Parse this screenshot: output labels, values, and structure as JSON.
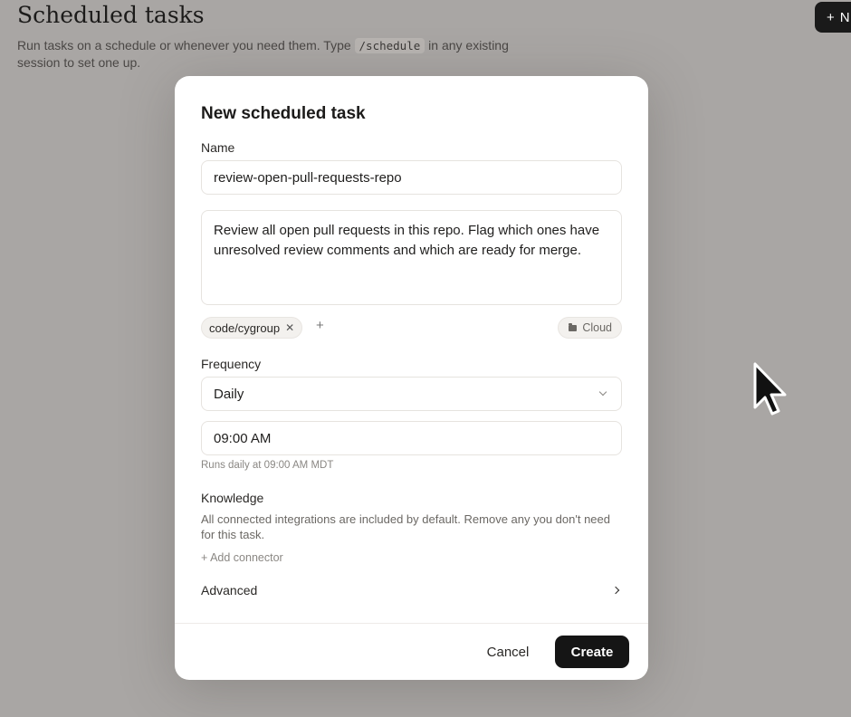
{
  "page": {
    "title": "Scheduled tasks",
    "subtitle_before": "Run tasks on a schedule or whenever you need them. Type",
    "subtitle_code": "/schedule",
    "subtitle_after": "in any existing session to set one up.",
    "new_button_label": "N"
  },
  "modal": {
    "title": "New scheduled task",
    "name_label": "Name",
    "name_value": "review-open-pull-requests-repo",
    "prompt_value": "Review all open pull requests in this repo. Flag which ones have unresolved review comments and which are ready for merge.",
    "repo_chip": "code/cygroup",
    "environment_chip": "Cloud",
    "frequency_label": "Frequency",
    "frequency_value": "Daily",
    "time_value": "09:00 AM",
    "runs_hint": "Runs daily at 09:00 AM MDT",
    "knowledge_label": "Knowledge",
    "knowledge_description": "All connected integrations are included by default. Remove any you don't need for this task.",
    "add_connector_label": "+ Add connector",
    "advanced_label": "Advanced",
    "cancel_label": "Cancel",
    "create_label": "Create"
  },
  "colors": {
    "backdrop": "#a9a6a4",
    "modal_bg": "#ffffff",
    "primary_button": "#151515"
  },
  "icons": [
    "plus-icon",
    "close-icon",
    "add-icon",
    "folder-icon",
    "chevron-down-icon",
    "chevron-right-icon",
    "mouse-cursor-icon"
  ]
}
